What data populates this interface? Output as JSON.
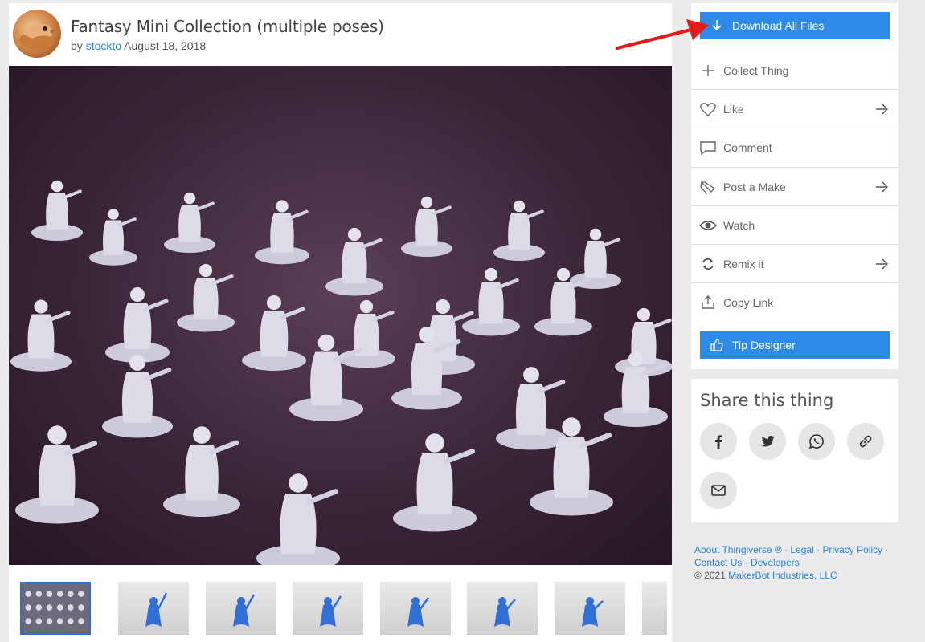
{
  "thing": {
    "title": "Fantasy Mini Collection (multiple poses)",
    "by_label": "by",
    "author": "stockto",
    "date": "August 18, 2018"
  },
  "actions": {
    "download_label": "Download All Files",
    "collect_label": "Collect Thing",
    "like_label": "Like",
    "comment_label": "Comment",
    "post_make_label": "Post a Make",
    "watch_label": "Watch",
    "remix_label": "Remix it",
    "copy_link_label": "Copy Link",
    "tip_label": "Tip Designer"
  },
  "share": {
    "title": "Share this thing",
    "buttons": [
      "facebook-icon",
      "twitter-icon",
      "whatsapp-icon",
      "link-icon",
      "email-icon"
    ]
  },
  "footer": {
    "about": "About Thingiverse",
    "registered": "®",
    "legal": "Legal",
    "privacy": "Privacy Policy",
    "contact": "Contact Us",
    "developers": "Developers",
    "copyright_prefix": "©  2021",
    "company": "MakerBot Industries, LLC",
    "separator": "·"
  },
  "colors": {
    "accent": "#2d8ae8",
    "link": "#2a85d8",
    "annotation": "#e31b1b",
    "thumb_model": "#2f6fd6"
  }
}
